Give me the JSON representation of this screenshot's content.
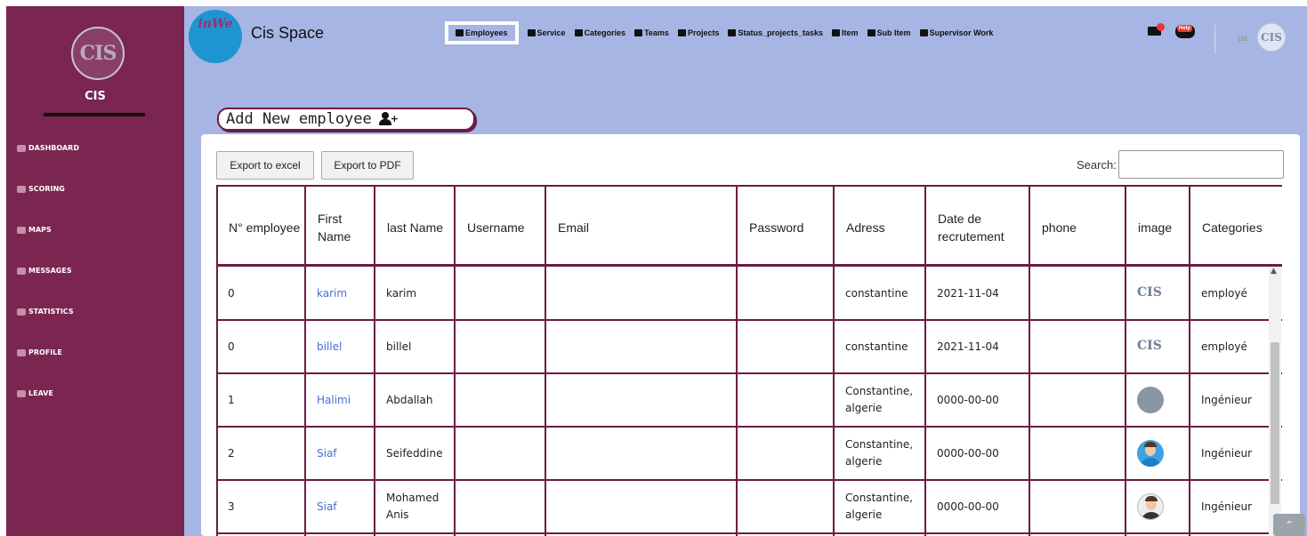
{
  "sidebar": {
    "logo_text": "CIS",
    "title": "CIS",
    "items": [
      {
        "label": "DASHBOARD"
      },
      {
        "label": "SCORING"
      },
      {
        "label": "MAPS"
      },
      {
        "label": "MESSAGES"
      },
      {
        "label": "STATISTICS"
      },
      {
        "label": "PROFILE"
      },
      {
        "label": "LEAVE"
      }
    ]
  },
  "header": {
    "brand_logo_text": "inWe",
    "brand_name": "Cis Space",
    "nav": [
      {
        "label": "Employees",
        "active": true
      },
      {
        "label": "Service"
      },
      {
        "label": "Categories"
      },
      {
        "label": "Teams"
      },
      {
        "label": "Projects"
      },
      {
        "label": "Status_projects_tasks"
      },
      {
        "label": "Item"
      },
      {
        "label": "Sub Item"
      },
      {
        "label": "Supervisor Work"
      }
    ],
    "help_label": "Help",
    "user_name": "cis",
    "user_avatar_text": "CIS"
  },
  "main": {
    "add_button_label": "Add New employee",
    "export_excel_label": "Export to excel",
    "export_pdf_label": "Export to PDF",
    "search_label": "Search:",
    "search_value": "",
    "columns": [
      "N° employee",
      "First Name",
      "last Name",
      "Username",
      "Email",
      "Password",
      "Adress",
      "Date de recrutement",
      "phone",
      "image",
      "Categories"
    ],
    "rows": [
      {
        "num": "0",
        "first": "karim",
        "last": "karim",
        "username": "",
        "email": "",
        "password": "",
        "adress": "constantine",
        "date": "2021-11-04",
        "phone": "",
        "image": "cis-logo",
        "category": "employé"
      },
      {
        "num": "0",
        "first": "billel",
        "last": "billel",
        "username": "",
        "email": "",
        "password": "",
        "adress": "constantine",
        "date": "2021-11-04",
        "phone": "",
        "image": "cis-logo",
        "category": "employé"
      },
      {
        "num": "1",
        "first": "Halimi",
        "last": "Abdallah",
        "username": "",
        "email": "",
        "password": "",
        "adress": "Constantine, algerie",
        "date": "0000-00-00",
        "phone": "",
        "image": "photo",
        "category": "Ingénieur"
      },
      {
        "num": "2",
        "first": "Siaf",
        "last": "Seifeddine",
        "username": "",
        "email": "",
        "password": "",
        "adress": "Constantine, algerie",
        "date": "0000-00-00",
        "phone": "",
        "image": "avatar-blue",
        "category": "Ingénieur"
      },
      {
        "num": "3",
        "first": "Siaf",
        "last": "Mohamed Anis",
        "username": "",
        "email": "",
        "password": "",
        "adress": "Constantine, algerie",
        "date": "0000-00-00",
        "phone": "",
        "image": "avatar-dark",
        "category": "Ingénieur"
      }
    ]
  },
  "colors": {
    "sidebar": "#7b2551",
    "topbar": "#a6b5e3",
    "table_border": "#6a1d44",
    "link": "#4a6bd6"
  }
}
